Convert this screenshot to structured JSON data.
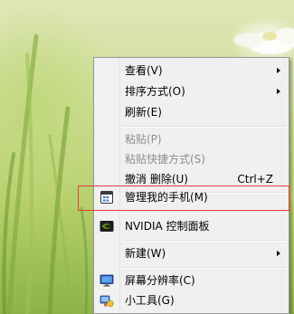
{
  "context_menu": {
    "items": [
      {
        "label": "查看(V)",
        "submenu": true
      },
      {
        "label": "排序方式(O)",
        "submenu": true
      },
      {
        "label": "刷新(E)"
      },
      {
        "label": "粘贴(P)",
        "disabled": true
      },
      {
        "label": "粘贴快捷方式(S)",
        "disabled": true
      },
      {
        "label": "撤消 删除(U)",
        "shortcut": "Ctrl+Z"
      },
      {
        "label": "管理我的手机(M)",
        "icon": "phone-manager-icon",
        "highlighted": true
      },
      {
        "label": "NVIDIA 控制面板",
        "icon": "nvidia-icon"
      },
      {
        "label": "新建(W)",
        "submenu": true
      },
      {
        "label": "屏幕分辨率(C)",
        "icon": "screen-resolution-icon"
      },
      {
        "label": "小工具(G)",
        "icon": "gadgets-icon"
      }
    ]
  },
  "colors": {
    "highlight_border": "#e03c3c",
    "menu_bg": "#f0f0f0",
    "disabled_text": "#8d8d8d"
  }
}
